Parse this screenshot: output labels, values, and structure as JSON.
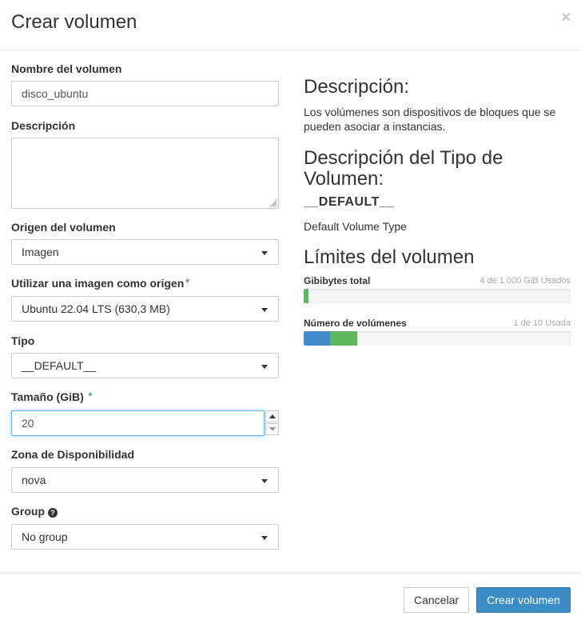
{
  "modal": {
    "title": "Crear volumen",
    "close_glyph": "×"
  },
  "form": {
    "name_label": "Nombre del volumen",
    "name_value": "disco_ubuntu",
    "description_label": "Descripción",
    "description_value": "",
    "source_label": "Origen del volumen",
    "source_value": "Imagen",
    "image_label": "Utilizar una imagen como origen",
    "image_value": "Ubuntu 22.04 LTS (630,3 MB)",
    "type_label": "Tipo",
    "type_value": "__DEFAULT__",
    "size_label": "Tamaño (GiB)",
    "size_value": "20",
    "zone_label": "Zona de Disponibilidad",
    "zone_value": "nova",
    "group_label": "Group",
    "group_help_glyph": "?",
    "group_value": "No group",
    "required_mark": "*"
  },
  "info": {
    "desc_heading": "Descripción:",
    "desc_text": "Los volúmenes son dispositivos de bloques que se pueden asociar a instancias.",
    "type_heading": "Descripción del Tipo de Volumen:",
    "type_name": "__DEFAULT__",
    "type_desc": "Default Volume Type",
    "limits_heading": "Límites del volumen",
    "quotas": [
      {
        "label": "Gibibytes total",
        "usage": "4 de 1.000 GiB Usados",
        "used_fraction": 0.004,
        "added_fraction": 0.02
      },
      {
        "label": "Número de volúmenes",
        "usage": "1 de 10 Usada",
        "used_fraction": 0.1,
        "added_fraction": 0.1
      }
    ]
  },
  "footer": {
    "cancel_label": "Cancelar",
    "submit_label": "Crear volumen"
  },
  "colors": {
    "accent": "#3c8dc5",
    "quota_used": "#428bca",
    "quota_added": "#5cb85c"
  }
}
